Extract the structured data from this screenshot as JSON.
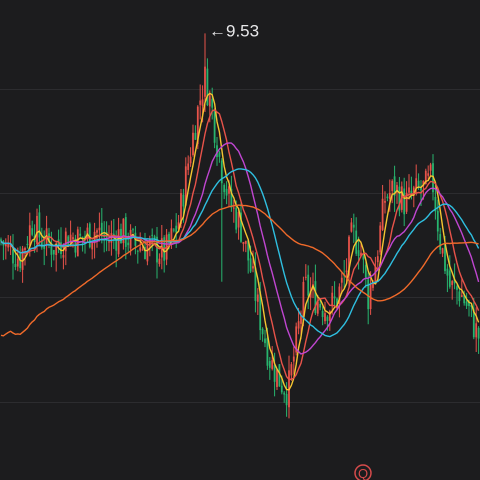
{
  "chart_data": {
    "type": "candlestick",
    "title": "",
    "high_marker": {
      "label": "9.53",
      "value": 9.53
    },
    "ylim": [
      5.25,
      9.85
    ],
    "grid": true,
    "gridlines_y": [
      9.0,
      8.0,
      7.0,
      6.0,
      5.0
    ],
    "bottom_marker": "Q",
    "colors": {
      "up": "#e8534a",
      "down": "#27b56e",
      "background": "#1c1c1e",
      "grid": "#2c2c2f",
      "text": "#e8e8ea"
    },
    "moving_averages": [
      {
        "color": "#f5c531"
      },
      {
        "color": "#e8534a"
      },
      {
        "color": "#c046d1"
      },
      {
        "color": "#2fbfe0"
      },
      {
        "color": "#f06a2a"
      }
    ],
    "close_anchors": [
      [
        0,
        7.55
      ],
      [
        10,
        7.45
      ],
      [
        20,
        7.38
      ],
      [
        32,
        7.72
      ],
      [
        42,
        7.55
      ],
      [
        55,
        7.48
      ],
      [
        68,
        7.6
      ],
      [
        80,
        7.55
      ],
      [
        95,
        7.65
      ],
      [
        108,
        7.55
      ],
      [
        122,
        7.62
      ],
      [
        135,
        7.5
      ],
      [
        150,
        7.48
      ],
      [
        165,
        7.42
      ],
      [
        178,
        7.7
      ],
      [
        190,
        8.4
      ],
      [
        200,
        8.9
      ],
      [
        205,
        9.1
      ],
      [
        212,
        8.8
      ],
      [
        220,
        8.3
      ],
      [
        230,
        7.9
      ],
      [
        240,
        7.7
      ],
      [
        250,
        7.3
      ],
      [
        260,
        6.8
      ],
      [
        270,
        6.4
      ],
      [
        280,
        6.2
      ],
      [
        288,
        6.1
      ],
      [
        295,
        6.5
      ],
      [
        305,
        7.1
      ],
      [
        315,
        7.0
      ],
      [
        325,
        6.9
      ],
      [
        335,
        6.95
      ],
      [
        345,
        7.2
      ],
      [
        352,
        7.6
      ],
      [
        360,
        7.5
      ],
      [
        368,
        7.0
      ],
      [
        375,
        7.3
      ],
      [
        385,
        7.95
      ],
      [
        395,
        8.05
      ],
      [
        405,
        7.9
      ],
      [
        415,
        8.0
      ],
      [
        425,
        8.05
      ],
      [
        432,
        8.15
      ],
      [
        440,
        7.55
      ],
      [
        450,
        7.1
      ],
      [
        460,
        7.05
      ],
      [
        468,
        6.9
      ],
      [
        475,
        6.7
      ],
      [
        480,
        6.6
      ]
    ]
  }
}
